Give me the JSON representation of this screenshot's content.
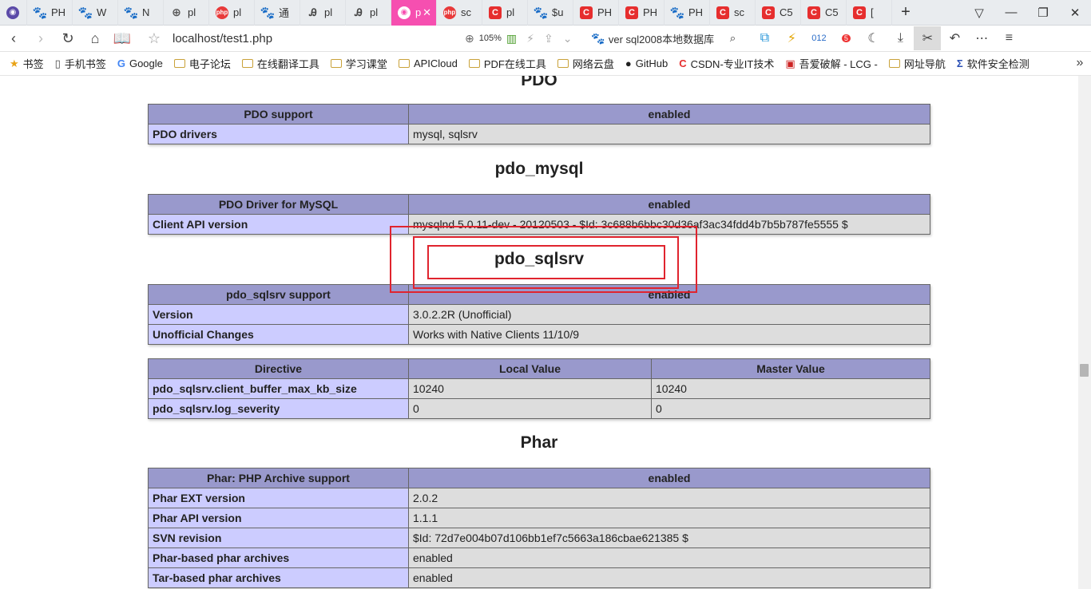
{
  "tabs": [
    {
      "label": "",
      "icon": "app-logo-icon"
    },
    {
      "label": "PH",
      "icon": "paw-icon"
    },
    {
      "label": "W",
      "icon": "paw-icon"
    },
    {
      "label": "N",
      "icon": "paw-icon"
    },
    {
      "label": "pl",
      "icon": "globe-icon"
    },
    {
      "label": "pl",
      "icon": "php-icon"
    },
    {
      "label": "通",
      "icon": "paw-icon"
    },
    {
      "label": "pl",
      "icon": "ui-icon"
    },
    {
      "label": "pl",
      "icon": "ui-icon"
    },
    {
      "label": "p",
      "icon": "pink-icon"
    },
    {
      "label": "sc",
      "icon": "php-icon"
    },
    {
      "label": "pl",
      "icon": "csdn-icon"
    },
    {
      "label": "$u",
      "icon": "paw-icon"
    },
    {
      "label": "PH",
      "icon": "csdn-icon"
    },
    {
      "label": "PH",
      "icon": "csdn-icon"
    },
    {
      "label": "PH",
      "icon": "paw-icon"
    },
    {
      "label": "sc",
      "icon": "csdn-icon"
    },
    {
      "label": "C5",
      "icon": "csdn-icon"
    },
    {
      "label": "C5",
      "icon": "csdn-icon"
    },
    {
      "label": "[",
      "icon": "csdn-icon"
    }
  ],
  "nav": {
    "url": "localhost/test1.php",
    "zoom": "105%",
    "search_text": "ver sql2008本地数据库",
    "badge_count": "5"
  },
  "bookmarks": [
    {
      "label": "书签",
      "icon": "star-icon"
    },
    {
      "label": "手机书签",
      "icon": "phone-icon"
    },
    {
      "label": "Google",
      "icon": "google-icon"
    },
    {
      "label": "电子论坛",
      "icon": "folder-icon"
    },
    {
      "label": "在线翻译工具",
      "icon": "folder-icon"
    },
    {
      "label": "学习课堂",
      "icon": "folder-icon"
    },
    {
      "label": "APICloud",
      "icon": "folder-icon"
    },
    {
      "label": "PDF在线工具",
      "icon": "folder-icon"
    },
    {
      "label": "网络云盘",
      "icon": "folder-icon"
    },
    {
      "label": "GitHub",
      "icon": "github-icon"
    },
    {
      "label": "CSDN-专业IT技术",
      "icon": "csdn-icon"
    },
    {
      "label": "吾爱破解 - LCG -",
      "icon": "pojie-icon"
    },
    {
      "label": "网址导航",
      "icon": "folder-icon"
    },
    {
      "label": "软件安全检测",
      "icon": "sigma-icon"
    }
  ],
  "page": {
    "pdo_title": "PDO",
    "pdo": {
      "head": [
        "PDO support",
        "enabled"
      ],
      "rows": [
        [
          "PDO drivers",
          "mysql, sqlsrv"
        ]
      ]
    },
    "pdo_mysql_title": "pdo_mysql",
    "pdo_mysql": {
      "head": [
        "PDO Driver for MySQL",
        "enabled"
      ],
      "rows": [
        [
          "Client API version",
          "mysqlnd 5.0.11-dev - 20120503 - $Id: 3c688b6bbc30d36af3ac34fdd4b7b5b787fe5555 $"
        ]
      ]
    },
    "pdo_sqlsrv_title": "pdo_sqlsrv",
    "pdo_sqlsrv": {
      "head": [
        "pdo_sqlsrv support",
        "enabled"
      ],
      "rows": [
        [
          "Version",
          "3.0.2.2R (Unofficial)"
        ],
        [
          "Unofficial Changes",
          "Works with Native Clients 11/10/9"
        ]
      ]
    },
    "pdo_sqlsrv_directives": {
      "head": [
        "Directive",
        "Local Value",
        "Master Value"
      ],
      "rows": [
        [
          "pdo_sqlsrv.client_buffer_max_kb_size",
          "10240",
          "10240"
        ],
        [
          "pdo_sqlsrv.log_severity",
          "0",
          "0"
        ]
      ]
    },
    "phar_title": "Phar",
    "phar": {
      "head": [
        "Phar: PHP Archive support",
        "enabled"
      ],
      "rows": [
        [
          "Phar EXT version",
          "2.0.2"
        ],
        [
          "Phar API version",
          "1.1.1"
        ],
        [
          "SVN revision",
          "$Id: 72d7e004b07d106bb1ef7c5663a186cbae621385 $"
        ],
        [
          "Phar-based phar archives",
          "enabled"
        ],
        [
          "Tar-based phar archives",
          "enabled"
        ]
      ]
    }
  }
}
